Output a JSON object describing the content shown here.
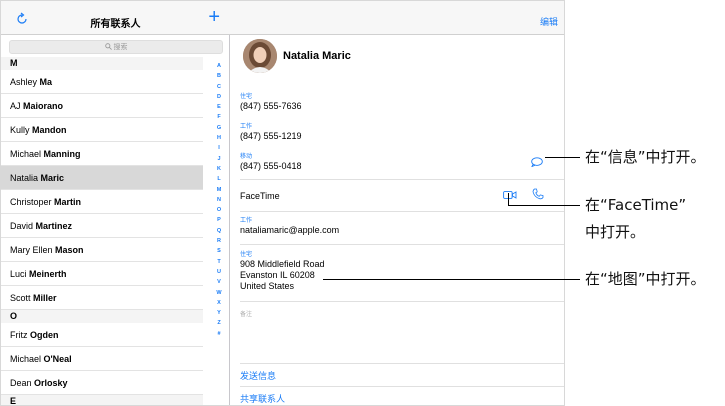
{
  "sidebar": {
    "title": "所有联系人",
    "add_label": "+",
    "search_placeholder": "搜索",
    "sections": [
      {
        "letter": "M",
        "contacts": [
          {
            "first": "Ashley",
            "last": "Ma"
          },
          {
            "first": "AJ",
            "last": "Maiorano"
          },
          {
            "first": "Kully",
            "last": "Mandon"
          },
          {
            "first": "Michael",
            "last": "Manning"
          },
          {
            "first": "Natalia",
            "last": "Maric",
            "selected": true
          },
          {
            "first": "Christoper",
            "last": "Martin"
          },
          {
            "first": "David",
            "last": "Martinez"
          },
          {
            "first": "Mary Ellen",
            "last": "Mason"
          },
          {
            "first": "Luci",
            "last": "Meinerth"
          },
          {
            "first": "Scott",
            "last": "Miller"
          }
        ]
      },
      {
        "letter": "O",
        "contacts": [
          {
            "first": "Fritz",
            "last": "Ogden"
          },
          {
            "first": "Michael",
            "last": "O'Neal"
          },
          {
            "first": "Dean",
            "last": "Orlosky"
          }
        ]
      },
      {
        "letter": "E",
        "contacts": []
      }
    ],
    "index_letters": [
      "A",
      "B",
      "C",
      "D",
      "E",
      "F",
      "G",
      "H",
      "I",
      "J",
      "K",
      "L",
      "M",
      "N",
      "O",
      "P",
      "Q",
      "R",
      "S",
      "T",
      "U",
      "V",
      "W",
      "X",
      "Y",
      "Z",
      "#"
    ]
  },
  "detail": {
    "edit_label": "编辑",
    "name": "Natalia Maric",
    "phones": [
      {
        "label": "住宅",
        "value": "(847) 555-7636"
      },
      {
        "label": "工作",
        "value": "(847) 555-1219"
      },
      {
        "label": "移动",
        "value": "(847) 555-0418"
      }
    ],
    "facetime_label": "FaceTime",
    "email": {
      "label": "工作",
      "value": "nataliamaric@apple.com"
    },
    "address": {
      "label": "住宅",
      "line1": "908 Middlefield Road",
      "line2": "Evanston IL 60208",
      "line3": "United States"
    },
    "notes_label": "备注",
    "send_message": "发送信息",
    "share_contact": "共享联系人"
  },
  "callouts": {
    "message": "在“信息”中打开。",
    "facetime_line1": "在“FaceTime”",
    "facetime_line2": "中打开。",
    "maps": "在“地图”中打开。"
  },
  "colors": {
    "accent": "#1a7cf6",
    "selected_row": "#d8d8d8"
  }
}
